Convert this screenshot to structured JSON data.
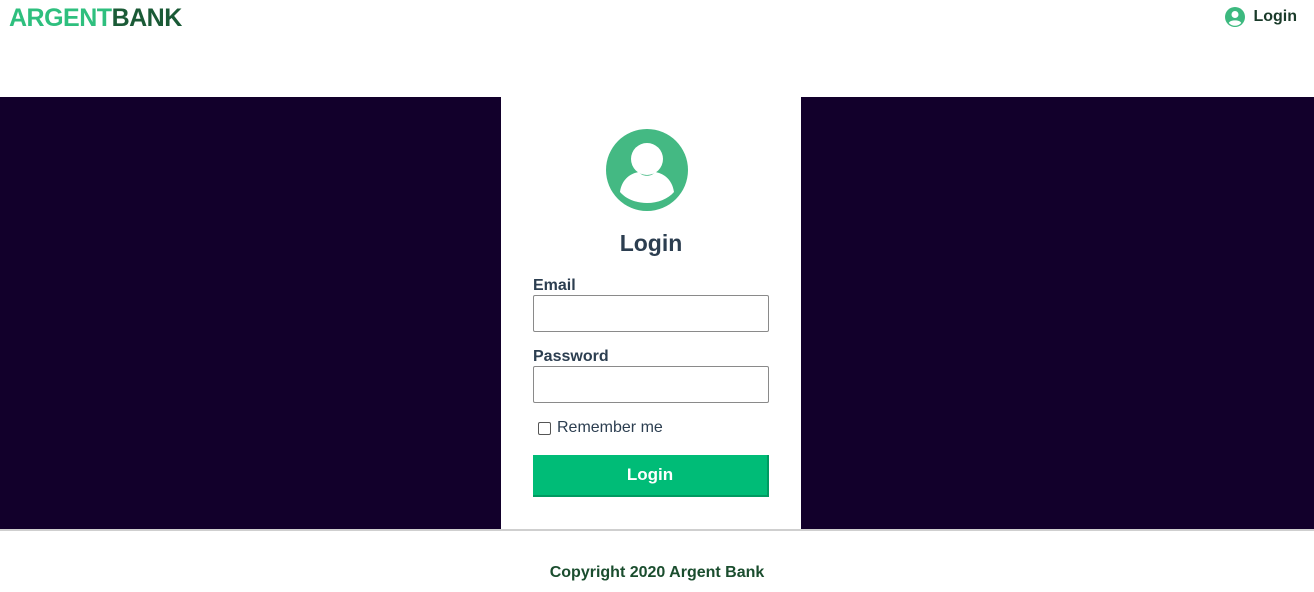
{
  "header": {
    "logo_part1": "ARGENT",
    "logo_part2": "BANK",
    "nav_login_label": "Login",
    "nav_icon": "user-circle-icon"
  },
  "login_card": {
    "avatar_icon": "user-avatar-icon",
    "title": "Login",
    "email_label": "Email",
    "email_value": "",
    "password_label": "Password",
    "password_value": "",
    "remember_label": "Remember me",
    "remember_checked": false,
    "submit_label": "Login"
  },
  "footer": {
    "copyright": "Copyright 2020 Argent Bank"
  },
  "colors": {
    "accent": "#00bc77",
    "hero_bg": "#12002b",
    "logo_green": "#2ebf7e",
    "logo_dark": "#1a5a36"
  }
}
